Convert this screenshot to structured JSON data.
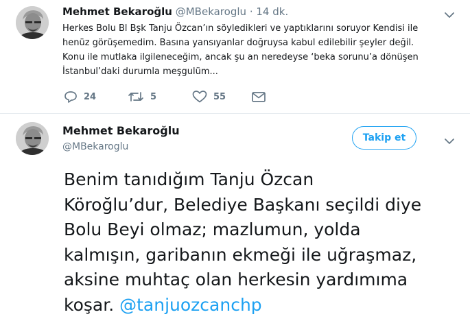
{
  "tweet1": {
    "author_name": "Mehmet Bekaroğlu",
    "author_handle": "@MBekaroglu",
    "separator": "·",
    "time": "14 dk.",
    "text_lines": [
      "Herkes Bolu Bl Bşk Tanju Özcan’ın söyledikleri ve yaptıklarını soruyor Kendisi ile",
      "henüz görüşemedim. Basına yansıyanlar doğruysa kabul edilebilir şeyler değil.",
      "Konu ile mutlaka ilgileneceğim, ancak şu an neredeyse ‘beka sorunu’a dönüşen",
      "İstanbul’daki durumla meşgulüm..."
    ],
    "reply_count": "24",
    "retweet_count": "5",
    "like_count": "55"
  },
  "tweet2": {
    "author_name": "Mehmet Bekaroğlu",
    "author_handle": "@MBekaroglu",
    "follow_label": "Takip et",
    "text_lines": [
      "Benim tanıdığım Tanju Özcan",
      "Köroğlu’dur, Belediye Başkanı seçildi diye",
      "Bolu Beyi olmaz; mazlumun, yolda",
      "kalmışın, garibanın ekmeği ile uğraşmaz,",
      "aksine muhtaç olan herkesin yardımıma"
    ],
    "last_line_text": "koşar.",
    "mention": "@tanjuozcanchp"
  },
  "icons": {
    "caret": "chevron-down-icon",
    "reply": "reply-icon",
    "retweet": "retweet-icon",
    "like": "heart-icon",
    "mail": "envelope-icon"
  },
  "colors": {
    "accent": "#1da1f2",
    "muted": "#657786",
    "text": "#14171a"
  }
}
